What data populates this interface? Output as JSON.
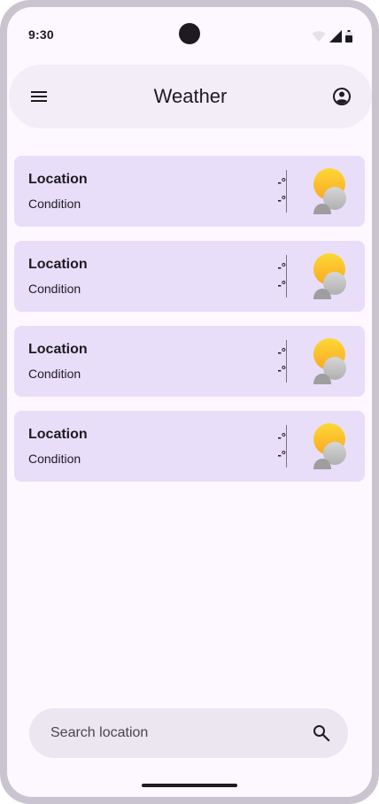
{
  "status_bar": {
    "time": "9:30",
    "icons": [
      "wifi-icon",
      "signal-icon",
      "battery-icon"
    ]
  },
  "top_bar": {
    "title": "Weather",
    "menu_icon": "menu-icon",
    "account_icon": "account-circle-icon"
  },
  "cards": [
    {
      "location": "Location",
      "condition": "Condition",
      "high": "-°",
      "low": "-°",
      "icon": "partly-cloudy-icon"
    },
    {
      "location": "Location",
      "condition": "Condition",
      "high": "-°",
      "low": "-°",
      "icon": "partly-cloudy-icon"
    },
    {
      "location": "Location",
      "condition": "Condition",
      "high": "-°",
      "low": "-°",
      "icon": "partly-cloudy-icon"
    },
    {
      "location": "Location",
      "condition": "Condition",
      "high": "-°",
      "low": "-°",
      "icon": "partly-cloudy-icon"
    }
  ],
  "search": {
    "placeholder": "Search location",
    "value": "",
    "icon": "search-icon"
  },
  "colors": {
    "background": "#fdf7ff",
    "top_bar": "#f3edf7",
    "card": "#e8defa",
    "search": "#ece6f0",
    "text": "#1d1b20",
    "sun": "#fbc02d",
    "cloud": "#bdbdbd"
  }
}
